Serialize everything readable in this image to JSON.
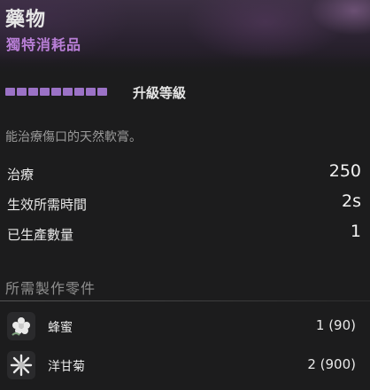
{
  "item": {
    "title": "藥物",
    "subtitle": "獨特消耗品"
  },
  "upgrade": {
    "label": "升級等級",
    "pips_filled": 9,
    "pip_color": "#9b72c6"
  },
  "description": "能治療傷口的天然軟膏。",
  "stats": [
    {
      "label": "治療",
      "value": "250"
    },
    {
      "label": "生效所需時間",
      "value": "2s"
    },
    {
      "label": "已生產數量",
      "value": "1"
    }
  ],
  "components": {
    "title": "所需製作零件",
    "items": [
      {
        "name": "蜂蜜",
        "qty": "1 (90)",
        "icon": "honey-flower-icon"
      },
      {
        "name": "洋甘菊",
        "qty": "2 (900)",
        "icon": "chamomile-flower-icon"
      }
    ]
  },
  "colors": {
    "accent": "#b97fd7",
    "background": "#1c1c1d"
  }
}
